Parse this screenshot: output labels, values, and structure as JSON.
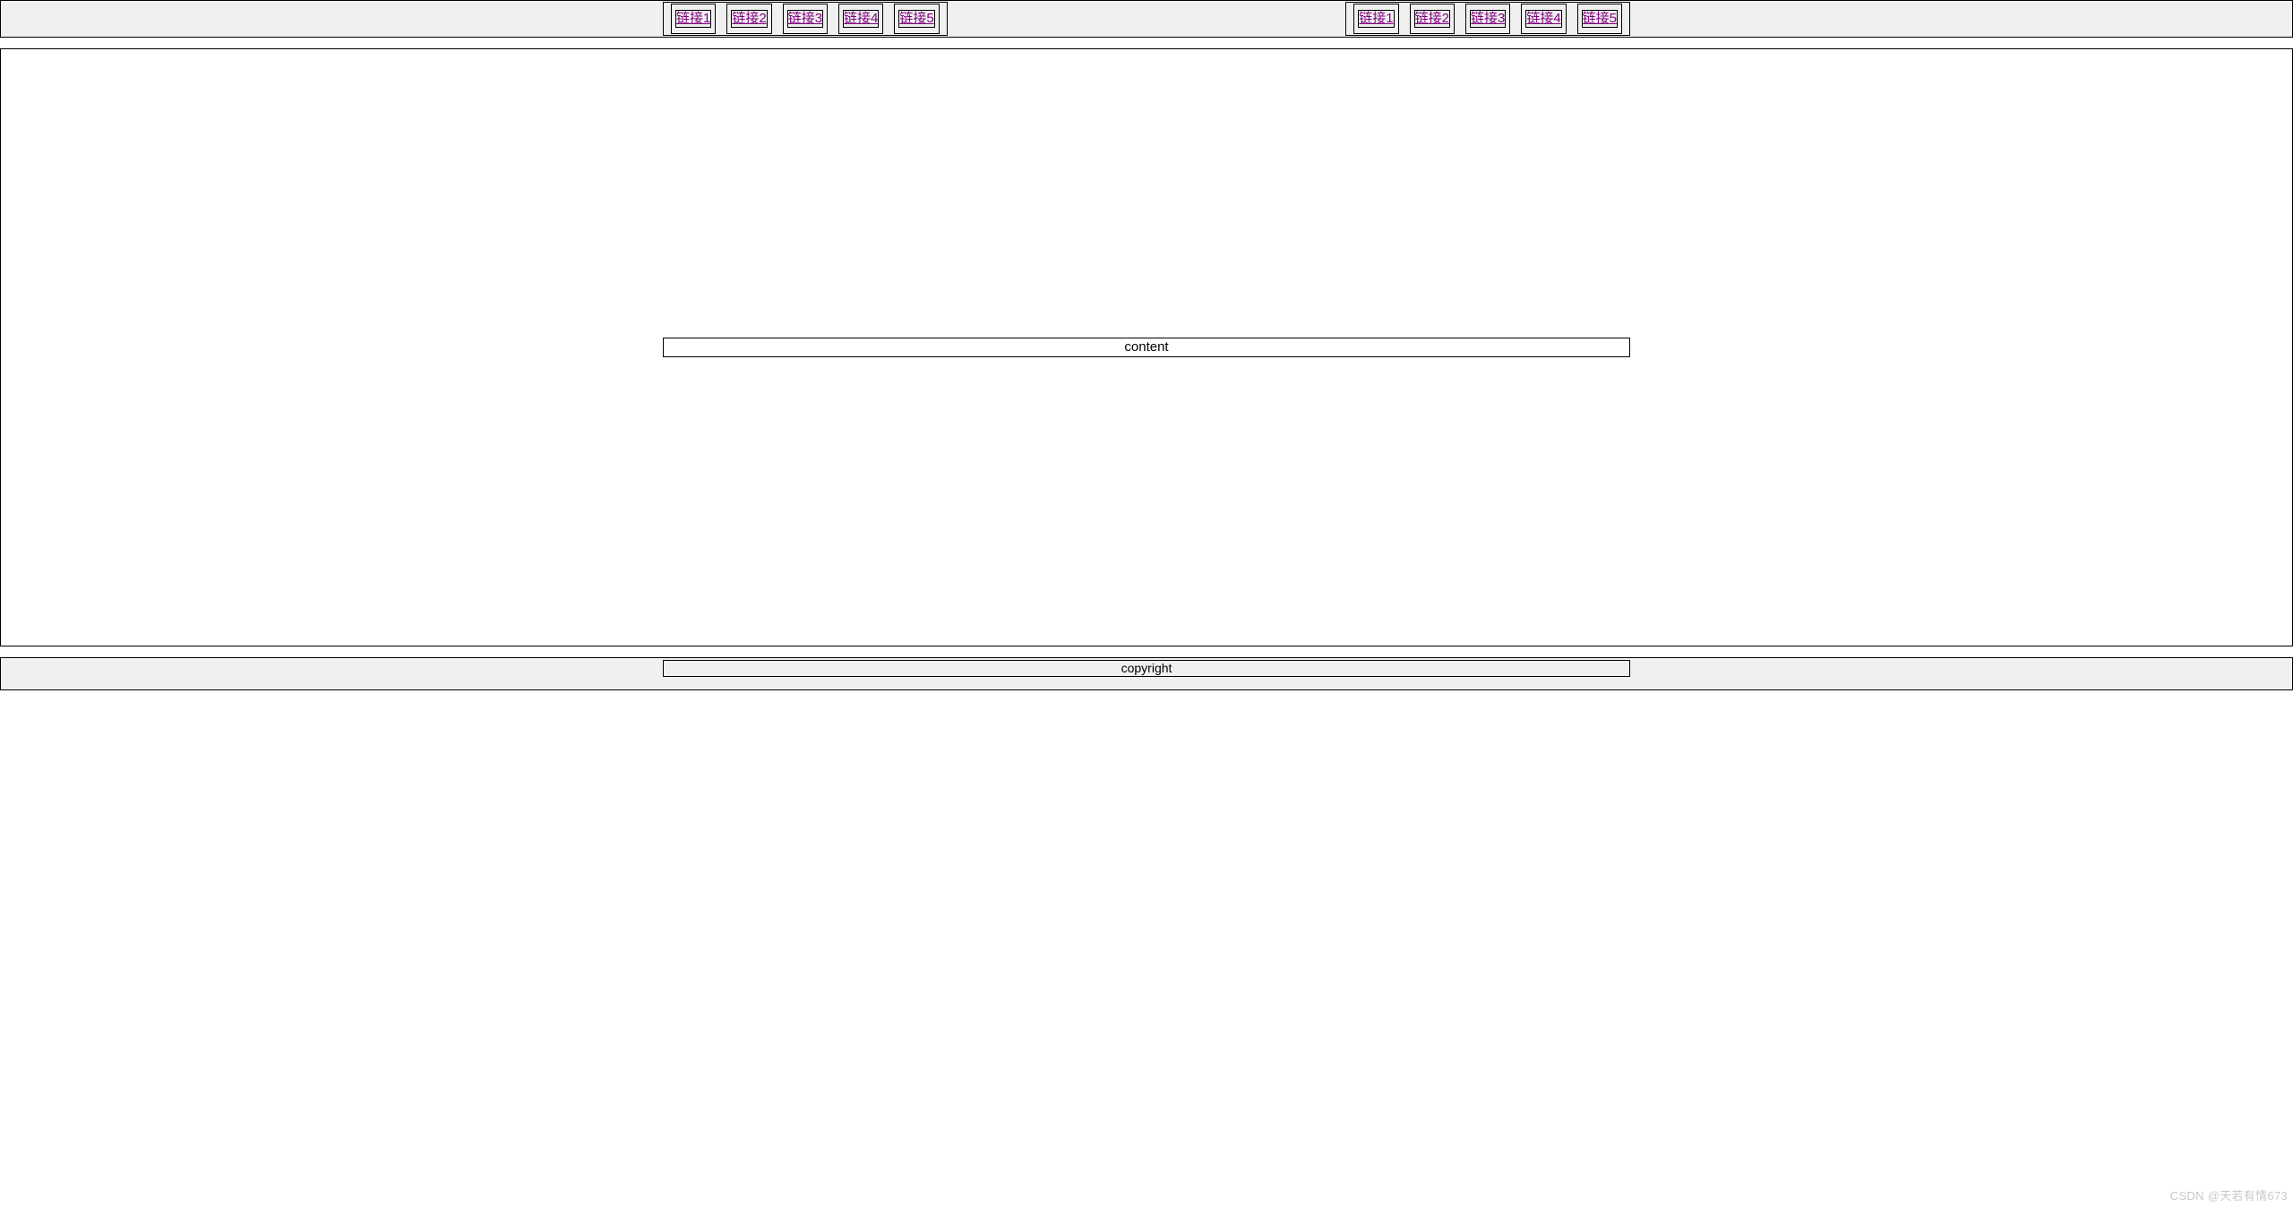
{
  "nav": {
    "left": [
      {
        "label": "链接1"
      },
      {
        "label": "链接2"
      },
      {
        "label": "链接3"
      },
      {
        "label": "链接4"
      },
      {
        "label": "链接5"
      }
    ],
    "right": [
      {
        "label": "链接1"
      },
      {
        "label": "链接2"
      },
      {
        "label": "链接3"
      },
      {
        "label": "链接4"
      },
      {
        "label": "链接5"
      }
    ]
  },
  "main": {
    "content_label": "content"
  },
  "footer": {
    "copyright_label": "copyright"
  },
  "watermark": "CSDN @天若有情673"
}
